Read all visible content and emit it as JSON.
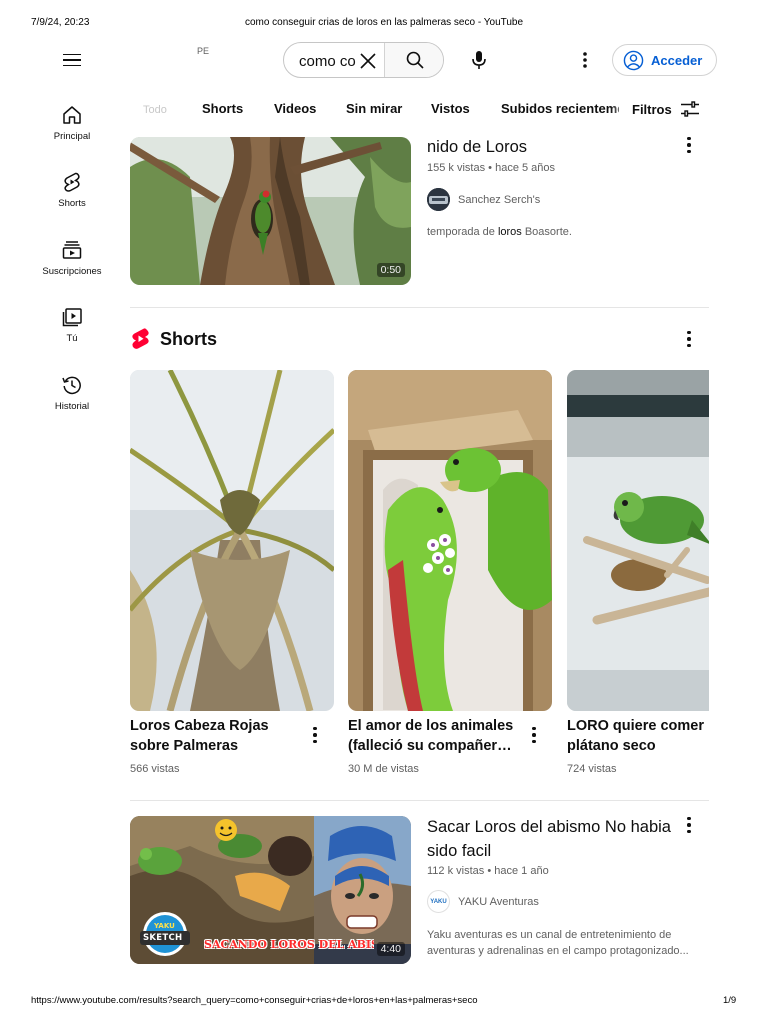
{
  "print_header": {
    "date": "7/9/24, 20:23",
    "title": "como conseguir crias de loros en las palmeras seco - YouTube"
  },
  "print_footer": {
    "url": "https://www.youtube.com/results?search_query=como+conseguir+crias+de+loros+en+las+palmeras+seco",
    "page": "1/9"
  },
  "topbar": {
    "country": "PE",
    "search_value": "como co",
    "login_label": "Acceder"
  },
  "sidebar": {
    "items": [
      {
        "label": "Principal",
        "icon": "home-icon"
      },
      {
        "label": "Shorts",
        "icon": "shorts-icon"
      },
      {
        "label": "Suscripciones",
        "icon": "subscriptions-icon"
      },
      {
        "label": "Tú",
        "icon": "you-icon"
      },
      {
        "label": "Historial",
        "icon": "history-icon"
      }
    ]
  },
  "chips": {
    "faded": "Todo",
    "items": [
      "Shorts",
      "Videos",
      "Sin mirar",
      "Vistos",
      "Subidos recientemente"
    ],
    "filters_label": "Filtros"
  },
  "videos": [
    {
      "title": "nido de Loros",
      "views": "155 k vistas",
      "age": "hace 5 años",
      "channel": "Sanchez Serch's",
      "description_parts": [
        "temporada de ",
        "loros",
        " Boasorte."
      ],
      "duration": "0:50"
    },
    {
      "title": "Sacar Loros del abismo No habia sido facil",
      "views": "112 k vistas",
      "age": "hace 1 año",
      "channel": "YAKU Aventuras",
      "description": "Yaku aventuras es un canal de entretenimiento de aventuras y adrenalinas en el campo protagonizado...",
      "duration": "4:40",
      "thumb_caption": "SACANDO LOROS DEL ABISMO",
      "thumb_logo_top": "YAKU",
      "thumb_logo_bottom": "SKETCH",
      "avatar_text": "YAKU"
    }
  ],
  "shorts": {
    "heading": "Shorts",
    "items": [
      {
        "title": "Loros Cabeza Rojas sobre Palmeras",
        "views": "566 vistas"
      },
      {
        "title": "El amor de los animales (falleció su compañer…",
        "views": "30 M de vistas"
      },
      {
        "title": "LORO quiere comer plátano seco",
        "views": "724 vistas"
      }
    ]
  },
  "colors": {
    "accent_blue": "#065fd4",
    "shorts_red": "#ff0033",
    "text_primary": "#0f0f0f",
    "text_secondary": "#606060"
  }
}
